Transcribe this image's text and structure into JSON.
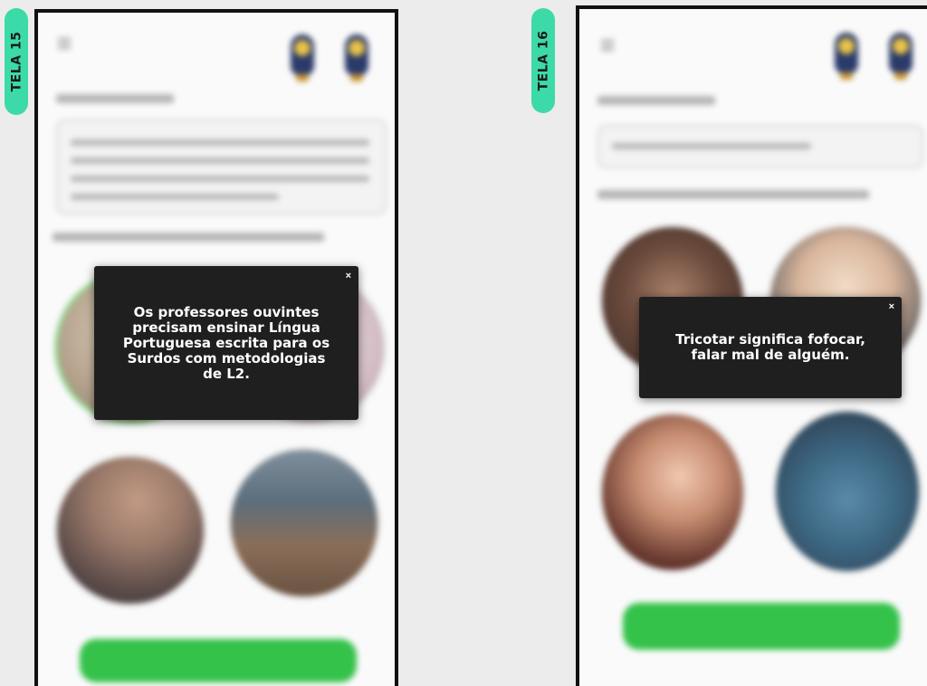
{
  "screens": [
    {
      "tag": "TELA 15",
      "popup": {
        "message": "Os professores ouvintes precisam ensinar Língua Portuguesa escrita para os Surdos com metodologias de L2.",
        "close_label": "×"
      }
    },
    {
      "tag": "TELA 16",
      "popup": {
        "message": "Tricotar significa fofocar, falar mal de alguém.",
        "close_label": "×"
      }
    }
  ],
  "colors": {
    "tag": "#3ddaa9",
    "button": "#35c24a",
    "popup_bg": "#1f1f1f",
    "selected_ring": "#8fd88f"
  },
  "icons": [
    "menu-icon",
    "owl-mascot-icon",
    "close-icon"
  ]
}
